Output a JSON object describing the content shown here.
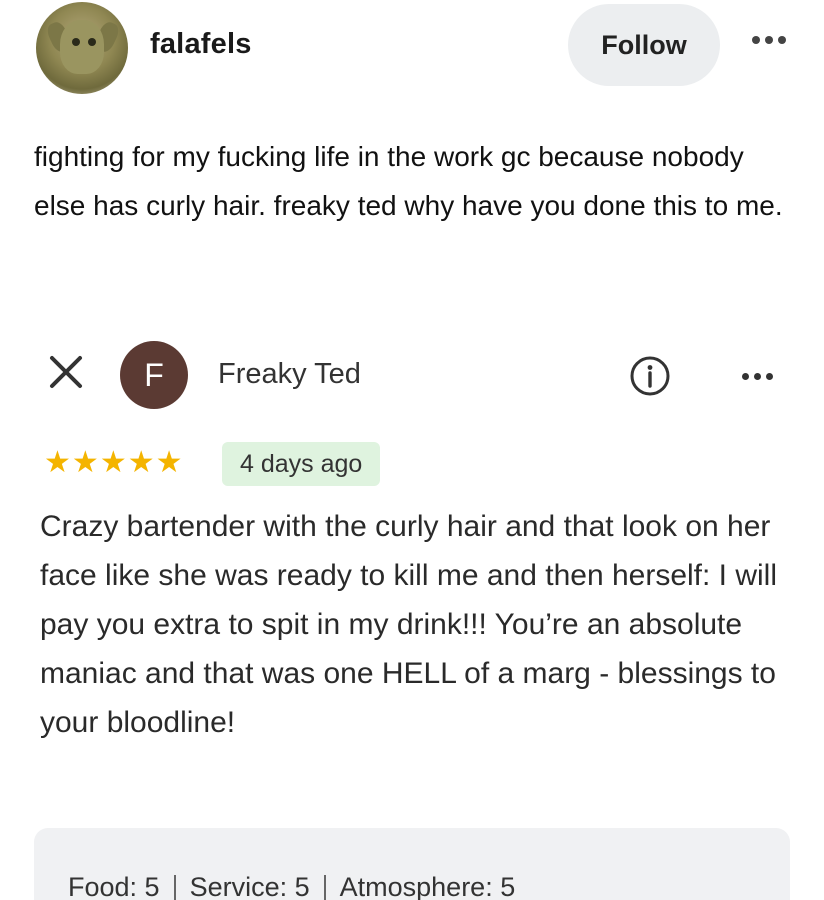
{
  "post": {
    "username": "falafels",
    "follow_label": "Follow",
    "text": "fighting for my fucking life in the work gc because nobody else has curly hair. freaky ted why have you done this to me."
  },
  "review": {
    "reviewer_initial": "F",
    "reviewer_name": "Freaky Ted",
    "rating_stars": 5,
    "time_ago": "4 days ago",
    "text": "Crazy bartender with the curly hair and that look on her face like she was ready to kill me and then herself: I will pay you extra to spit in my drink!!! You’re an absolute maniac and that was one HELL of a marg - blessings to your bloodline!",
    "ratings": [
      {
        "label": "Food: 5"
      },
      {
        "label": "Service: 5"
      },
      {
        "label": "Atmosphere: 5"
      }
    ]
  },
  "colors": {
    "star": "#f4b400",
    "reviewer_avatar": "#5b3a33",
    "time_badge_bg": "#dff3df",
    "follow_bg": "#eceef0"
  }
}
